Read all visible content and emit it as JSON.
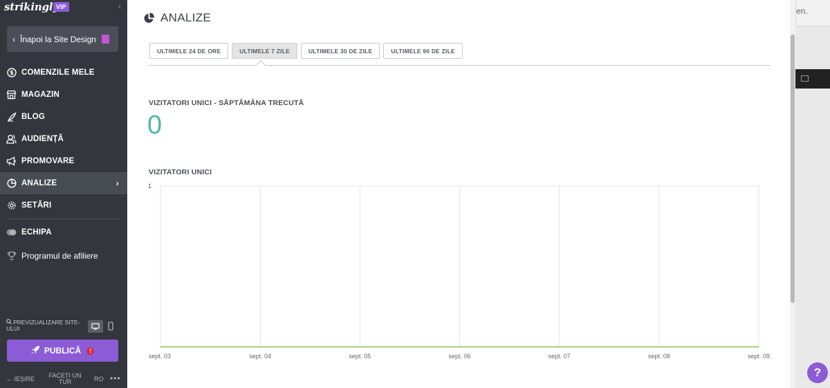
{
  "brand": {
    "logo": "strikingly",
    "badge": "VIP"
  },
  "sidebar": {
    "back_label": "Înapoi la Site Design",
    "items": [
      {
        "label": "COMENZILE MELE",
        "icon": "dollar-circle-icon"
      },
      {
        "label": "MAGAZIN",
        "icon": "store-icon"
      },
      {
        "label": "BLOG",
        "icon": "feather-pen-icon"
      },
      {
        "label": "AUDIENȚĂ",
        "icon": "users-icon"
      },
      {
        "label": "PROMOVARE",
        "icon": "megaphone-icon"
      },
      {
        "label": "ANALIZE",
        "icon": "pie-chart-icon",
        "active": true
      },
      {
        "label": "SETĂRI",
        "icon": "gear-icon"
      },
      {
        "label": "ECHIPA",
        "icon": "team-icon"
      },
      {
        "label": "Programul de afiliere",
        "icon": "trophy-icon"
      }
    ],
    "preview_label": "PREVIZUALIZARE SITE-ULUI",
    "publish_label": "PUBLICĂ",
    "exit_label": "IEȘIRE",
    "tour_label": "FACEȚI UN TUR",
    "lang_label": "RO"
  },
  "main": {
    "title": "ANALIZE",
    "tabs": [
      {
        "label": "ULTIMELE 24 DE ORE"
      },
      {
        "label": "ULTIMELE 7 ZILE",
        "active": true
      },
      {
        "label": "ULTIMELE 30 DE ZILE"
      },
      {
        "label": "ULTIMELE 90 DE ZILE"
      }
    ],
    "kpi_label": "VIZITATORI UNICI - SĂPTĂMÂNA TRECUTĂ",
    "kpi_value": "0",
    "chart_label": "VIZITATORI UNICI"
  },
  "chart_data": {
    "type": "line",
    "title": "VIZITATORI UNICI",
    "x": [
      "sept. 03",
      "sept. 04",
      "sept. 05",
      "sept. 06",
      "sept. 07",
      "sept. 08",
      "sept. 09"
    ],
    "series": [
      {
        "values": [
          0,
          0,
          0,
          0,
          0,
          0,
          0
        ],
        "color": "#8bc34a"
      }
    ],
    "ylim": [
      0,
      1
    ],
    "yticks": [
      "1"
    ],
    "grid": true
  },
  "background": {
    "top_text": "en."
  },
  "help_label": "?",
  "colors": {
    "accent": "#8b5cd6",
    "kpi": "#4fb8a8",
    "sidebar": "#33373d",
    "line": "#8bc34a"
  }
}
